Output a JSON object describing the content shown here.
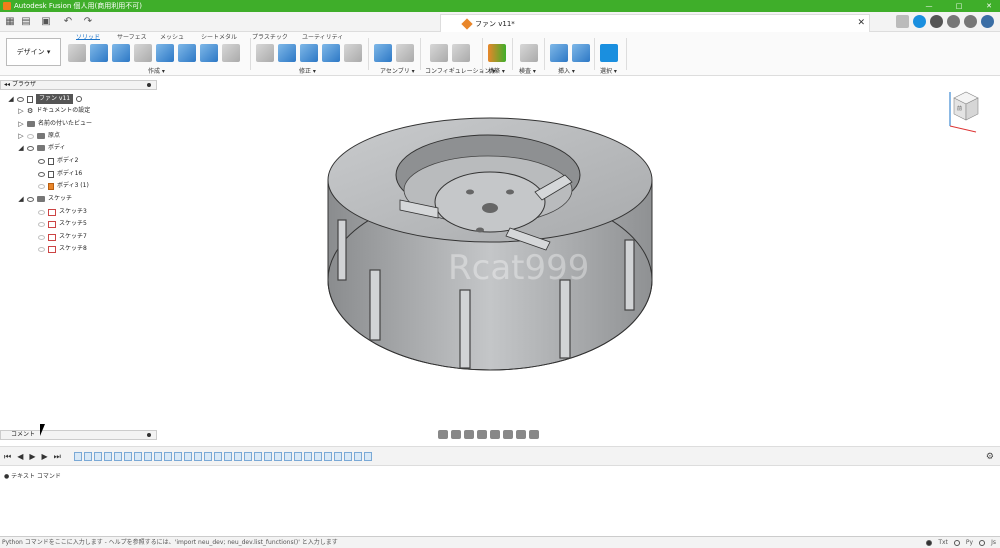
{
  "window": {
    "title": "Autodesk Fusion 個人用(商用利用不可)",
    "controls": [
      "—",
      "□",
      "✕"
    ]
  },
  "document": {
    "tab_name": "ファン v11*"
  },
  "workspace": {
    "label": "デザイン ▾"
  },
  "ribbon": {
    "tabs": [
      "ソリッド",
      "サーフェス",
      "メッシュ",
      "シートメタル",
      "プラスチック",
      "ユーティリティ"
    ],
    "groups": [
      "作成 ▾",
      "修正 ▾",
      "アセンブリ ▾",
      "コンフィギュレーション ▾",
      "構築 ▾",
      "検査 ▾",
      "挿入 ▾",
      "選択 ▾"
    ]
  },
  "browser": {
    "title": "ブラウザ",
    "root": "ファン v11",
    "items": [
      {
        "label": "ドキュメントの設定"
      },
      {
        "label": "名前の付いたビュー"
      },
      {
        "label": "原点"
      },
      {
        "label": "ボディ"
      },
      {
        "label": "ボディ2"
      },
      {
        "label": "ボディ16"
      },
      {
        "label": "ボディ3 (1)"
      },
      {
        "label": "スケッチ"
      },
      {
        "label": "スケッチ3"
      },
      {
        "label": "スケッチ5"
      },
      {
        "label": "スケッチ7"
      },
      {
        "label": "スケッチ8"
      }
    ]
  },
  "comments": {
    "title": "コメント"
  },
  "text_commands": {
    "title": "テキスト コマンド"
  },
  "status": {
    "hint": "Python コマンドをここに入力します - ヘルプを参照するには、'import neu_dev; neu_dev.list_functions()' と入力します",
    "modes": [
      "Txt",
      "Py",
      "Js"
    ]
  },
  "viewport": {
    "watermark": "Rcat999",
    "viewcube_face": "前"
  },
  "colors": {
    "titlebar": "#3fae2a",
    "accent": "#1a73c9",
    "model": "#bdbfc1"
  }
}
